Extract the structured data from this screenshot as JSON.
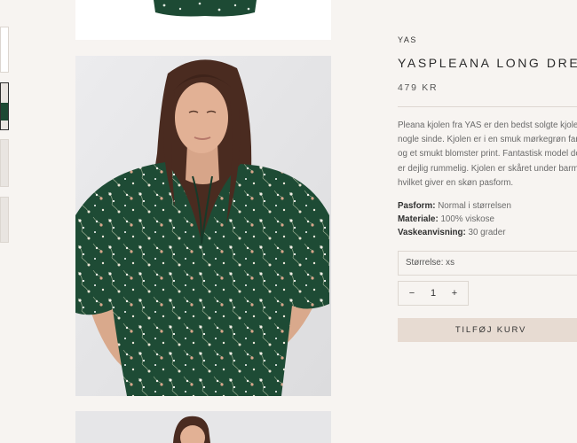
{
  "product": {
    "vendor": "YAS",
    "title": "YASPLEANA LONG DRESS",
    "price": "479 KR",
    "description": "Pleana kjolen fra YAS er den bedst solgte kjole nogle sinde. Kjolen er i en smuk mørkegrøn farve og et smukt blomster print. Fantastisk model der er dejlig rummelig. Kjolen er skåret under barmen, hvilket giver en skøn pasform.",
    "specs": [
      {
        "label": "Pasform:",
        "value": "Normal i størrelsen"
      },
      {
        "label": "Materiale:",
        "value": "100% viskose"
      },
      {
        "label": "Vaskeanvisning:",
        "value": "30 grader"
      }
    ]
  },
  "size_select": {
    "label": "Størrelse: xs"
  },
  "quantity": {
    "minus": "−",
    "value": "1",
    "plus": "+"
  },
  "add_to_cart": {
    "label": "TILFØJ KURV"
  },
  "colors": {
    "background": "#f7f4f1",
    "dress_green": "#1d4a34",
    "button": "#e7dbd2"
  }
}
